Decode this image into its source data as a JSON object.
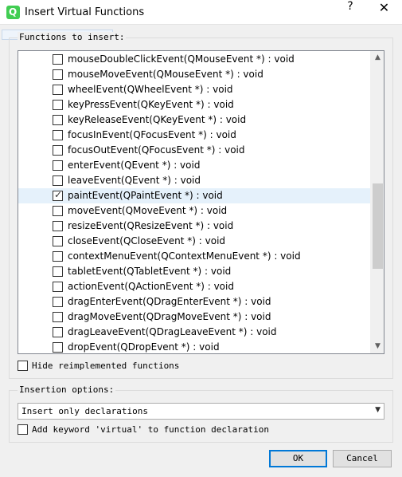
{
  "window": {
    "title": "Insert Virtual Functions",
    "help_label": "?",
    "close_label": "✕",
    "app_icon_letter": "Q"
  },
  "functions_group": {
    "title": "Functions to insert:",
    "items": [
      {
        "label": "mouseDoubleClickEvent(QMouseEvent *) : void",
        "checked": false
      },
      {
        "label": "mouseMoveEvent(QMouseEvent *) : void",
        "checked": false
      },
      {
        "label": "wheelEvent(QWheelEvent *) : void",
        "checked": false
      },
      {
        "label": "keyPressEvent(QKeyEvent *) : void",
        "checked": false
      },
      {
        "label": "keyReleaseEvent(QKeyEvent *) : void",
        "checked": false
      },
      {
        "label": "focusInEvent(QFocusEvent *) : void",
        "checked": false
      },
      {
        "label": "focusOutEvent(QFocusEvent *) : void",
        "checked": false
      },
      {
        "label": "enterEvent(QEvent *) : void",
        "checked": false
      },
      {
        "label": "leaveEvent(QEvent *) : void",
        "checked": false
      },
      {
        "label": "paintEvent(QPaintEvent *) : void",
        "checked": true,
        "selected": true
      },
      {
        "label": "moveEvent(QMoveEvent *) : void",
        "checked": false
      },
      {
        "label": "resizeEvent(QResizeEvent *) : void",
        "checked": false
      },
      {
        "label": "closeEvent(QCloseEvent *) : void",
        "checked": false
      },
      {
        "label": "contextMenuEvent(QContextMenuEvent *) : void",
        "checked": false
      },
      {
        "label": "tabletEvent(QTabletEvent *) : void",
        "checked": false
      },
      {
        "label": "actionEvent(QActionEvent *) : void",
        "checked": false
      },
      {
        "label": "dragEnterEvent(QDragEnterEvent *) : void",
        "checked": false
      },
      {
        "label": "dragMoveEvent(QDragMoveEvent *) : void",
        "checked": false
      },
      {
        "label": "dragLeaveEvent(QDragLeaveEvent *) : void",
        "checked": false
      },
      {
        "label": "dropEvent(QDropEvent *) : void",
        "checked": false
      }
    ],
    "hide_reimplemented_label": "Hide reimplemented functions",
    "hide_reimplemented_checked": false
  },
  "insertion_group": {
    "title": "Insertion options:",
    "mode_selected": "Insert only declarations",
    "add_virtual_label": "Add keyword 'virtual' to function declaration",
    "add_virtual_checked": false
  },
  "buttons": {
    "ok_label": "OK",
    "cancel_label": "Cancel"
  },
  "colors": {
    "accent": "#0078d7",
    "selection": "#e5f1fb",
    "qt_green": "#41cd52"
  }
}
